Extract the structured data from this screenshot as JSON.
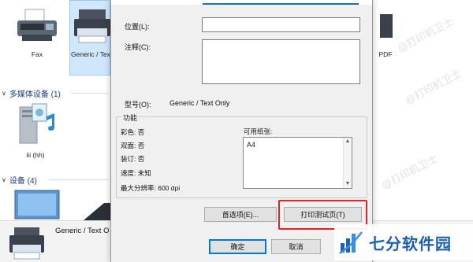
{
  "explorer": {
    "printers": [
      {
        "label": "Fax"
      },
      {
        "label": "Generic / Text Only"
      },
      {
        "label": "PDF"
      }
    ],
    "groups": [
      {
        "label": "多媒体设备 (1)"
      },
      {
        "label": "设备 (4)"
      }
    ],
    "media_device": {
      "label": "iii (hh)"
    },
    "statusbar_title": "Generic / Text O"
  },
  "dialog": {
    "location_label": "位置(L):",
    "comment_label": "注释(C):",
    "model_label": "型号(O):",
    "model_value": "Generic / Text Only",
    "features_label": "功能",
    "features": [
      {
        "text": "彩色: 否"
      },
      {
        "text": "双面: 否"
      },
      {
        "text": "装订: 否"
      },
      {
        "text": "速度: 未知"
      },
      {
        "text": "最大分辨率: 600 dpi"
      }
    ],
    "paper_label": "可用纸张:",
    "paper_items": [
      "A4"
    ],
    "preferences_button": "首选项(E)...",
    "print_test_button": "打印测试页(T)",
    "ok_button": "确定",
    "cancel_button": "取消"
  },
  "watermark_text": "@打印机卫士",
  "brand_name": "七分软件园",
  "colors": {
    "accent": "#0078d7",
    "highlight": "#e02424",
    "brand": "#1f5fb3"
  }
}
